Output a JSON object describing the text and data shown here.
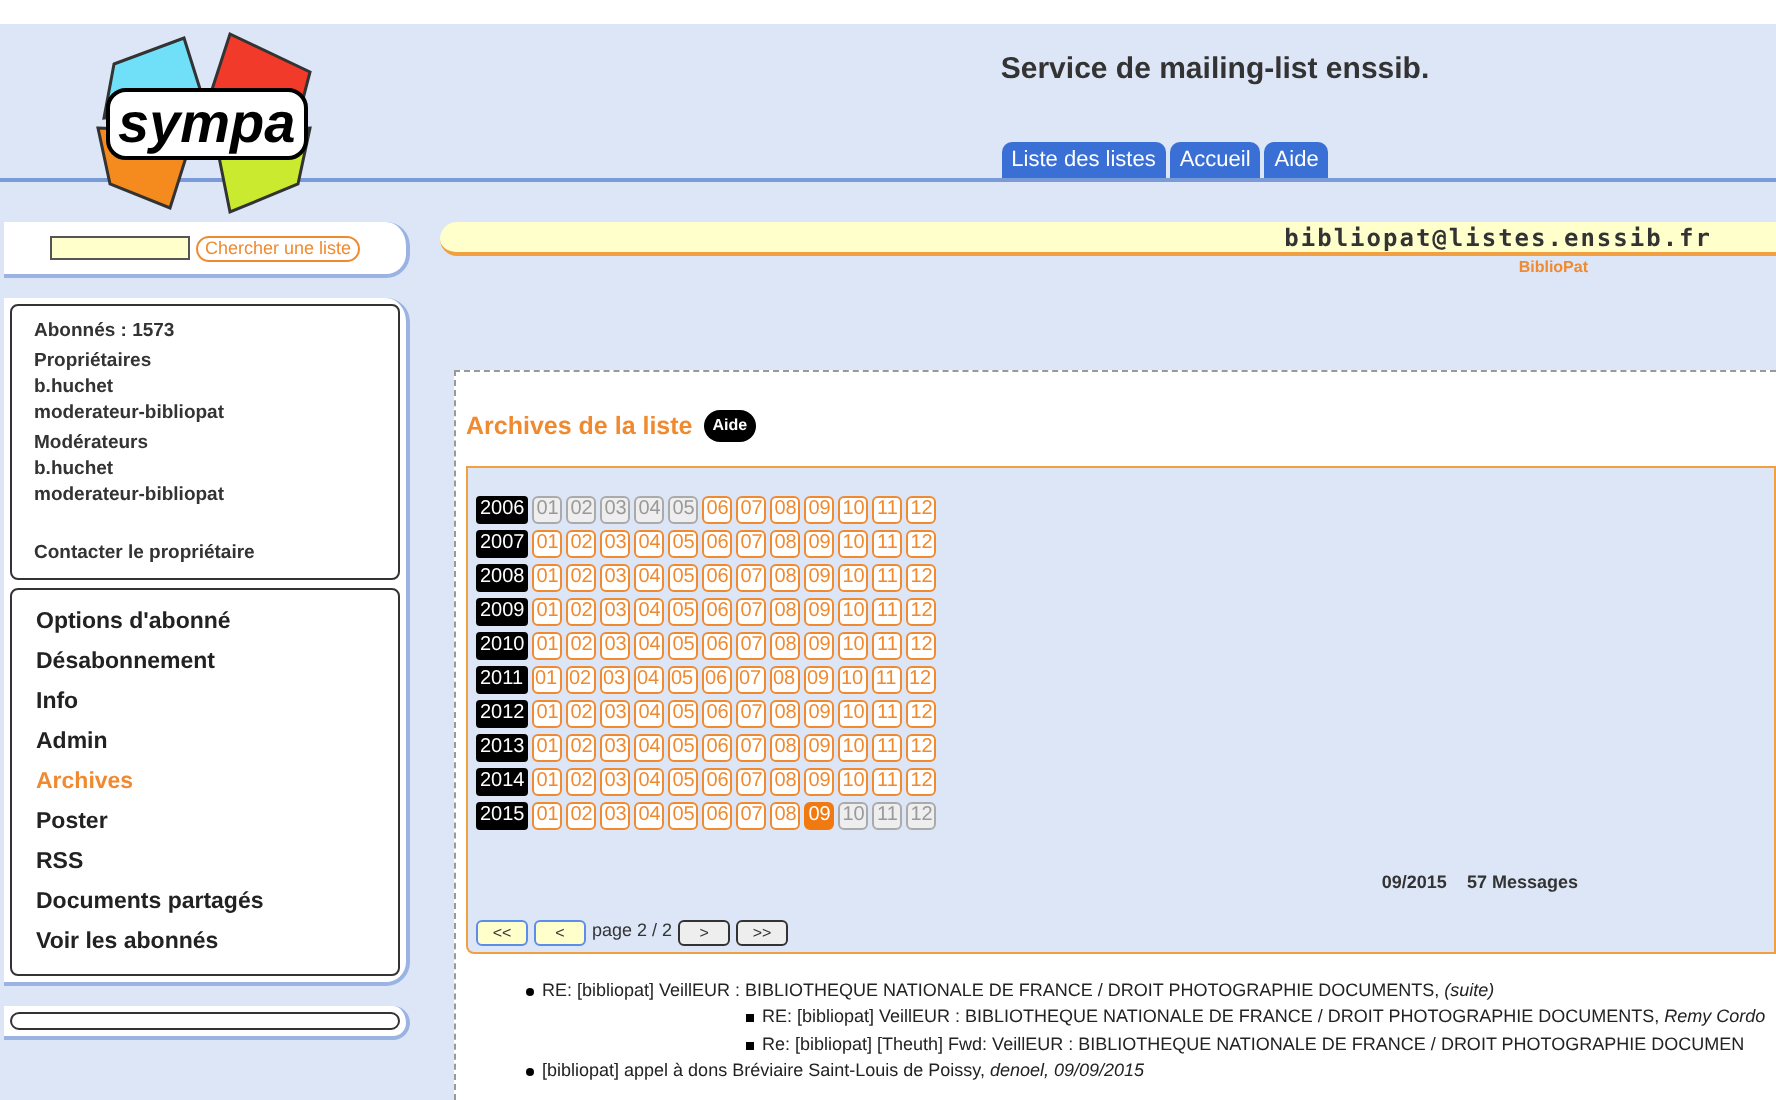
{
  "logo": {
    "text": "sympa"
  },
  "header": {
    "title": "Service de mailing-list enssib."
  },
  "tabs": [
    {
      "label": "Liste des listes",
      "selected": false
    },
    {
      "label": "Accueil",
      "selected": false
    },
    {
      "label": "Aide",
      "selected": false
    }
  ],
  "search": {
    "button": "Chercher une liste"
  },
  "list_banner": {
    "address": "bibliopat@listes.enssib.fr",
    "name": "BiblioPat"
  },
  "list_info": {
    "subscribers": "Abonnés : 1573",
    "owners_label": "Propriétaires",
    "owners": [
      "b.huchet",
      "moderateur-bibliopat"
    ],
    "moderators_label": "Modérateurs",
    "moderators": [
      "b.huchet",
      "moderateur-bibliopat"
    ],
    "contact": "Contacter le propriétaire"
  },
  "menu": [
    {
      "label": "Options d'abonné",
      "selected": false
    },
    {
      "label": "Désabonnement",
      "selected": false
    },
    {
      "label": "Info",
      "selected": false
    },
    {
      "label": "Admin",
      "selected": false
    },
    {
      "label": "Archives",
      "selected": true
    },
    {
      "label": "Poster",
      "selected": false
    },
    {
      "label": "RSS",
      "selected": false
    },
    {
      "label": "Documents partagés",
      "selected": false
    },
    {
      "label": "Voir les abonnés",
      "selected": false
    }
  ],
  "archives": {
    "title": "Archives de la liste",
    "help": "Aide",
    "years": [
      {
        "year": "2006",
        "months": [
          {
            "label": "01",
            "kind": "empty"
          },
          {
            "label": "02",
            "kind": "empty"
          },
          {
            "label": "03",
            "kind": "empty"
          },
          {
            "label": "04",
            "kind": "empty"
          },
          {
            "label": "05",
            "kind": "empty"
          },
          {
            "label": "06",
            "kind": "available"
          },
          {
            "label": "07",
            "kind": "available"
          },
          {
            "label": "08",
            "kind": "available"
          },
          {
            "label": "09",
            "kind": "available"
          },
          {
            "label": "10",
            "kind": "available"
          },
          {
            "label": "11",
            "kind": "available"
          },
          {
            "label": "12",
            "kind": "available"
          }
        ]
      },
      {
        "year": "2007",
        "months": [
          {
            "label": "01",
            "kind": "available"
          },
          {
            "label": "02",
            "kind": "available"
          },
          {
            "label": "03",
            "kind": "available"
          },
          {
            "label": "04",
            "kind": "available"
          },
          {
            "label": "05",
            "kind": "available"
          },
          {
            "label": "06",
            "kind": "available"
          },
          {
            "label": "07",
            "kind": "available"
          },
          {
            "label": "08",
            "kind": "available"
          },
          {
            "label": "09",
            "kind": "available"
          },
          {
            "label": "10",
            "kind": "available"
          },
          {
            "label": "11",
            "kind": "available"
          },
          {
            "label": "12",
            "kind": "available"
          }
        ]
      },
      {
        "year": "2008",
        "months": [
          {
            "label": "01",
            "kind": "available"
          },
          {
            "label": "02",
            "kind": "available"
          },
          {
            "label": "03",
            "kind": "available"
          },
          {
            "label": "04",
            "kind": "available"
          },
          {
            "label": "05",
            "kind": "available"
          },
          {
            "label": "06",
            "kind": "available"
          },
          {
            "label": "07",
            "kind": "available"
          },
          {
            "label": "08",
            "kind": "available"
          },
          {
            "label": "09",
            "kind": "available"
          },
          {
            "label": "10",
            "kind": "available"
          },
          {
            "label": "11",
            "kind": "available"
          },
          {
            "label": "12",
            "kind": "available"
          }
        ]
      },
      {
        "year": "2009",
        "months": [
          {
            "label": "01",
            "kind": "available"
          },
          {
            "label": "02",
            "kind": "available"
          },
          {
            "label": "03",
            "kind": "available"
          },
          {
            "label": "04",
            "kind": "available"
          },
          {
            "label": "05",
            "kind": "available"
          },
          {
            "label": "06",
            "kind": "available"
          },
          {
            "label": "07",
            "kind": "available"
          },
          {
            "label": "08",
            "kind": "available"
          },
          {
            "label": "09",
            "kind": "available"
          },
          {
            "label": "10",
            "kind": "available"
          },
          {
            "label": "11",
            "kind": "available"
          },
          {
            "label": "12",
            "kind": "available"
          }
        ]
      },
      {
        "year": "2010",
        "months": [
          {
            "label": "01",
            "kind": "available"
          },
          {
            "label": "02",
            "kind": "available"
          },
          {
            "label": "03",
            "kind": "available"
          },
          {
            "label": "04",
            "kind": "available"
          },
          {
            "label": "05",
            "kind": "available"
          },
          {
            "label": "06",
            "kind": "available"
          },
          {
            "label": "07",
            "kind": "available"
          },
          {
            "label": "08",
            "kind": "available"
          },
          {
            "label": "09",
            "kind": "available"
          },
          {
            "label": "10",
            "kind": "available"
          },
          {
            "label": "11",
            "kind": "available"
          },
          {
            "label": "12",
            "kind": "available"
          }
        ]
      },
      {
        "year": "2011",
        "months": [
          {
            "label": "01",
            "kind": "available"
          },
          {
            "label": "02",
            "kind": "available"
          },
          {
            "label": "03",
            "kind": "available"
          },
          {
            "label": "04",
            "kind": "available"
          },
          {
            "label": "05",
            "kind": "available"
          },
          {
            "label": "06",
            "kind": "available"
          },
          {
            "label": "07",
            "kind": "available"
          },
          {
            "label": "08",
            "kind": "available"
          },
          {
            "label": "09",
            "kind": "available"
          },
          {
            "label": "10",
            "kind": "available"
          },
          {
            "label": "11",
            "kind": "available"
          },
          {
            "label": "12",
            "kind": "available"
          }
        ]
      },
      {
        "year": "2012",
        "months": [
          {
            "label": "01",
            "kind": "available"
          },
          {
            "label": "02",
            "kind": "available"
          },
          {
            "label": "03",
            "kind": "available"
          },
          {
            "label": "04",
            "kind": "available"
          },
          {
            "label": "05",
            "kind": "available"
          },
          {
            "label": "06",
            "kind": "available"
          },
          {
            "label": "07",
            "kind": "available"
          },
          {
            "label": "08",
            "kind": "available"
          },
          {
            "label": "09",
            "kind": "available"
          },
          {
            "label": "10",
            "kind": "available"
          },
          {
            "label": "11",
            "kind": "available"
          },
          {
            "label": "12",
            "kind": "available"
          }
        ]
      },
      {
        "year": "2013",
        "months": [
          {
            "label": "01",
            "kind": "available"
          },
          {
            "label": "02",
            "kind": "available"
          },
          {
            "label": "03",
            "kind": "available"
          },
          {
            "label": "04",
            "kind": "available"
          },
          {
            "label": "05",
            "kind": "available"
          },
          {
            "label": "06",
            "kind": "available"
          },
          {
            "label": "07",
            "kind": "available"
          },
          {
            "label": "08",
            "kind": "available"
          },
          {
            "label": "09",
            "kind": "available"
          },
          {
            "label": "10",
            "kind": "available"
          },
          {
            "label": "11",
            "kind": "available"
          },
          {
            "label": "12",
            "kind": "available"
          }
        ]
      },
      {
        "year": "2014",
        "months": [
          {
            "label": "01",
            "kind": "available"
          },
          {
            "label": "02",
            "kind": "available"
          },
          {
            "label": "03",
            "kind": "available"
          },
          {
            "label": "04",
            "kind": "available"
          },
          {
            "label": "05",
            "kind": "available"
          },
          {
            "label": "06",
            "kind": "available"
          },
          {
            "label": "07",
            "kind": "available"
          },
          {
            "label": "08",
            "kind": "available"
          },
          {
            "label": "09",
            "kind": "available"
          },
          {
            "label": "10",
            "kind": "available"
          },
          {
            "label": "11",
            "kind": "available"
          },
          {
            "label": "12",
            "kind": "available"
          }
        ]
      },
      {
        "year": "2015",
        "months": [
          {
            "label": "01",
            "kind": "available"
          },
          {
            "label": "02",
            "kind": "available"
          },
          {
            "label": "03",
            "kind": "available"
          },
          {
            "label": "04",
            "kind": "available"
          },
          {
            "label": "05",
            "kind": "available"
          },
          {
            "label": "06",
            "kind": "available"
          },
          {
            "label": "07",
            "kind": "available"
          },
          {
            "label": "08",
            "kind": "available"
          },
          {
            "label": "09",
            "kind": "current"
          },
          {
            "label": "10",
            "kind": "empty"
          },
          {
            "label": "11",
            "kind": "empty"
          },
          {
            "label": "12",
            "kind": "empty"
          }
        ]
      }
    ],
    "period": "09/2015",
    "count": "57 Messages",
    "pager": {
      "buttons": [
        {
          "label": "<<",
          "disabled": false
        },
        {
          "label": "<",
          "disabled": false
        },
        {
          "label": ">",
          "disabled": true
        },
        {
          "label": ">>",
          "disabled": true
        }
      ],
      "page": "page 2 / 2"
    }
  },
  "messages": [
    {
      "subject": "RE: [bibliopat] VeillEUR : BIBLIOTHEQUE NATIONALE DE FRANCE / DROIT PHOTOGRAPHIE DOCUMENTS,",
      "meta": "(suite)",
      "children": [
        {
          "subject": "RE: [bibliopat] VeillEUR : BIBLIOTHEQUE NATIONALE DE FRANCE / DROIT PHOTOGRAPHIE DOCUMENTS,",
          "meta": "Remy Cordo"
        },
        {
          "subject": "Re: [bibliopat] [Theuth] Fwd: VeillEUR : BIBLIOTHEQUE NATIONALE DE FRANCE / DROIT PHOTOGRAPHIE DOCUMEN"
        }
      ]
    },
    {
      "subject": "[bibliopat] appel à dons Bréviaire Saint-Louis de Poissy,",
      "meta": "denoel, 09/09/2015"
    }
  ]
}
